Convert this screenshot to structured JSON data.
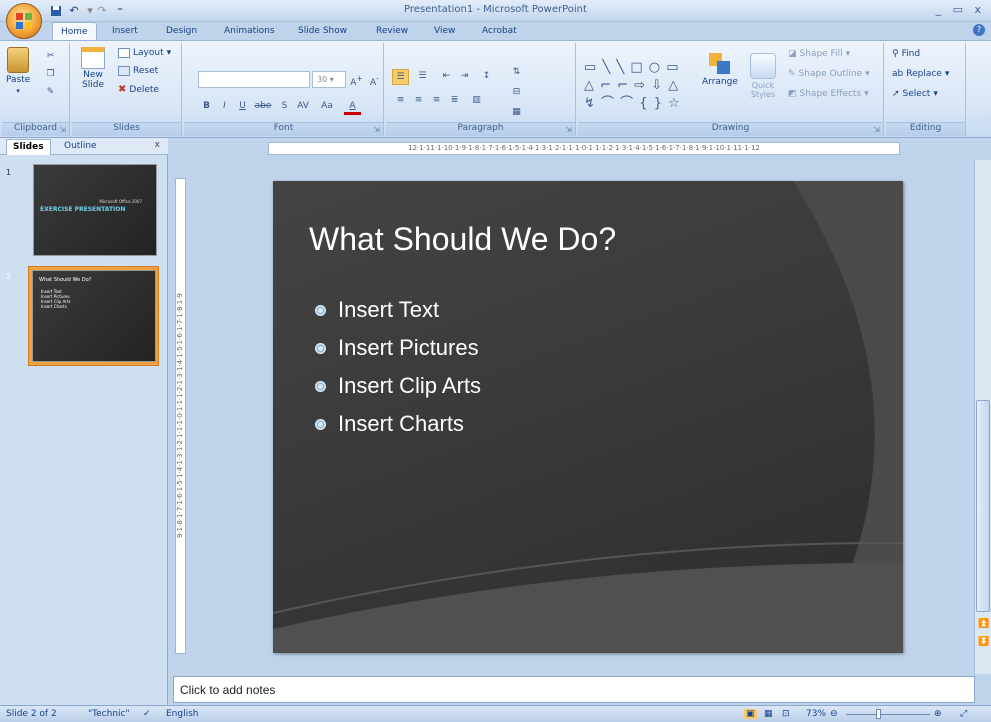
{
  "app": {
    "window_title": "Presentation1 - Microsoft PowerPoint",
    "office_button_label": "Office",
    "window_controls": "_ ▭ x"
  },
  "qat": {
    "save_icon": "save-icon",
    "undo_icon": "undo-icon",
    "redo_icon": "redo-icon"
  },
  "tabs": [
    "Home",
    "Insert",
    "Design",
    "Animations",
    "Slide Show",
    "Review",
    "View",
    "Acrobat"
  ],
  "active_tab": "Home",
  "ribbon": {
    "clipboard": {
      "paste": "Paste",
      "group": "Clipboard"
    },
    "slides": {
      "new_slide": "New Slide",
      "layout": "Layout",
      "reset": "Reset",
      "delete": "Delete",
      "group": "Slides"
    },
    "font": {
      "font_name": "",
      "font_size": "30",
      "group": "Font",
      "bold": "B",
      "italic": "I",
      "underline": "U",
      "strike": "abe",
      "shadow": "S",
      "spacing": "AV",
      "case": "Aa",
      "color": "A"
    },
    "paragraph": {
      "group": "Paragraph"
    },
    "drawing": {
      "arrange": "Arrange",
      "quick_styles": "Quick Styles",
      "shape_fill": "Shape Fill",
      "shape_outline": "Shape Outline",
      "shape_effects": "Shape Effects",
      "group": "Drawing"
    },
    "editing": {
      "find": "Find",
      "replace": "Replace",
      "select": "Select",
      "group": "Editing"
    }
  },
  "pane": {
    "tabs": [
      "Slides",
      "Outline"
    ],
    "close": "x",
    "thumbnails": [
      {
        "number": "1",
        "title": "EXERCISE PRESENTATION",
        "subtitle": "Microsoft Office 2007"
      },
      {
        "number": "2",
        "title": "What Should We Do?",
        "bullets": [
          "Insert Text",
          "Insert Pictures",
          "Insert Clip Arts",
          "Insert Charts"
        ]
      }
    ]
  },
  "ruler": {
    "horizontal": "12·1·11·1·10·1·9·1·8·1·7·1·6·1·5·1·4·1·3·1·2·1·1·1·0·1·1·1·2·1·3·1·4·1·5·1·6·1·7·1·8·1·9·1·10·1·11·1·12",
    "vertical": "9·1·8·1·7·1·6·1·5·1·4·1·3·1·2·1·1·1·0·1·1·1·2·1·3·1·4·1·5·1·6·1·7·1·8·1·9"
  },
  "slide": {
    "title": "What Should We Do?",
    "bullets": [
      "Insert Text",
      "Insert Pictures",
      "Insert Clip Arts",
      "Insert Charts"
    ]
  },
  "notes": {
    "placeholder": "Click to add notes"
  },
  "status": {
    "slide": "Slide 2 of 2",
    "theme": "\"Technic\"",
    "language": "English",
    "zoom": "73%"
  },
  "colors": {
    "accent": "#f3a140",
    "ribbon": "#d7e5f6",
    "slide_bg": "#3a3a3a"
  }
}
